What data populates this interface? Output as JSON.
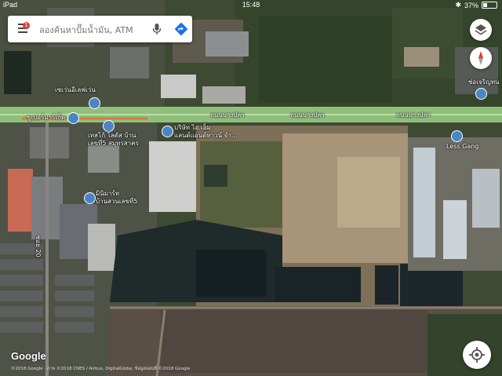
{
  "status_bar": {
    "carrier": "iPad",
    "time": "15:48",
    "battery": "37%"
  },
  "search": {
    "placeholder": "ลองค้นหาปั๊มน้ำมัน, ATM",
    "notification_count": "1"
  },
  "roads": {
    "main_road_1": "ถนนบางปลา",
    "main_road_2": "ถนนบางปลา",
    "main_road_3": "ถนนบางปลา",
    "side_road": "ซอย 20"
  },
  "places": [
    {
      "label": "เซเว่นอีเลฟเว่น",
      "icon": "shopping-bag-icon"
    },
    {
      "label": "ซูเปอร์มาร์เก็ต",
      "icon": "cart-icon"
    },
    {
      "label": "เทสโก้ โลตัส บ้าน\nเลขที่5 สมุทรสาคร",
      "icon": "shopping-bag-icon"
    },
    {
      "label": "บริษัท ไอ.เอ็ม\nแลนด์แอนด์ทาวน์ จำ...",
      "icon": "place-pin-icon"
    },
    {
      "label": "มินิมาร์ท\nบ้านสวนเลขที่5",
      "icon": "shopping-bag-icon"
    },
    {
      "label": "Less Gang",
      "icon": "place-pin-icon"
    },
    {
      "label": "ช่อเจริญทน",
      "icon": "place-pin-icon"
    }
  ],
  "branding": {
    "logo": "Google",
    "copyright": "©2018 Google · ภาพ ©2018 CNES / Airbus, DigitalGlobe, ข้อมูลแผนที่ ©2018 Google"
  },
  "colors": {
    "route_highlight": "#d97b3a",
    "road": "#9fd08a",
    "pin": "#4a86c5",
    "search_badge": "#e53935",
    "compass_red": "#e53935"
  }
}
